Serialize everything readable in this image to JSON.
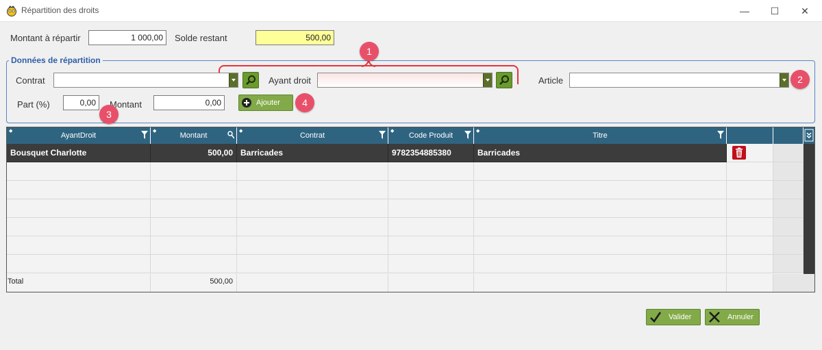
{
  "window": {
    "title": "Répartition des droits",
    "minimize": "—",
    "maximize": "☐",
    "close": "✕"
  },
  "top": {
    "montant_label": "Montant à répartir",
    "montant_value": "1 000,00",
    "solde_label": "Solde restant",
    "solde_value": "500,00"
  },
  "group": {
    "title": "Données de répartition",
    "contrat_label": "Contrat",
    "ayant_droit_label": "Ayant droit",
    "article_label": "Article",
    "part_label": "Part (%)",
    "part_value": "0,00",
    "montant_label": "Montant",
    "montant_value": "0,00",
    "ajouter_label": "Ajouter"
  },
  "badges": [
    "1",
    "2",
    "3",
    "4"
  ],
  "grid": {
    "columns": [
      "AyantDroit",
      "Montant",
      "Contrat",
      "Code Produit",
      "Titre"
    ],
    "rows": [
      {
        "ayant_droit": "Bousquet Charlotte",
        "montant": "500,00",
        "contrat": "Barricades",
        "code_produit": "9782354885380",
        "titre": "Barricades"
      }
    ],
    "total_label": "Total",
    "total_montant": "500,00"
  },
  "footer": {
    "valider_label": "Valider",
    "annuler_label": "Annuler"
  },
  "colors": {
    "accent_green": "#82aa48",
    "header_blue": "#2f6481",
    "highlight_yellow": "#ffff99",
    "badge_pink": "#e8506a",
    "delete_red": "#c0101a"
  },
  "icons": [
    "app-icon",
    "search-icon",
    "plus-circle-icon",
    "sort-icon",
    "filter-icon",
    "key-icon",
    "trash-icon",
    "column-chooser-icon",
    "check-icon",
    "close-x-icon"
  ]
}
